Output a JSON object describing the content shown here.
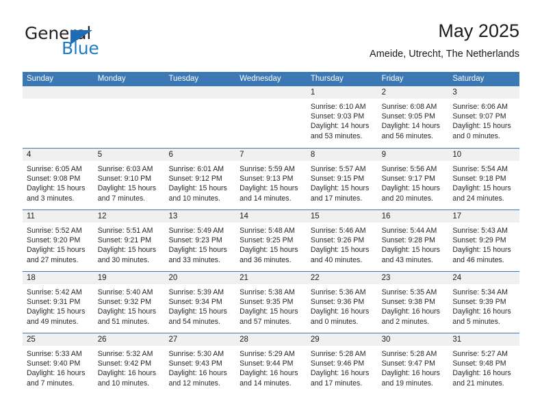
{
  "logo": {
    "word_top": "General",
    "word_bottom": "Blue",
    "accent_color": "#1a7cc2",
    "triangle_color": "#1f6cb4",
    "triangle_icon": "triangle-icon"
  },
  "header": {
    "title": "May 2025",
    "subtitle": "Ameide, Utrecht, The Netherlands"
  },
  "theme": {
    "header_blue": "#3b78b4",
    "daynum_band": "#f0f0f0",
    "text": "#262626"
  },
  "weekdays": [
    "Sunday",
    "Monday",
    "Tuesday",
    "Wednesday",
    "Thursday",
    "Friday",
    "Saturday"
  ],
  "weeks": [
    [
      {
        "date": "",
        "sunrise": "",
        "sunset": "",
        "daylight_a": "",
        "daylight_b": ""
      },
      {
        "date": "",
        "sunrise": "",
        "sunset": "",
        "daylight_a": "",
        "daylight_b": ""
      },
      {
        "date": "",
        "sunrise": "",
        "sunset": "",
        "daylight_a": "",
        "daylight_b": ""
      },
      {
        "date": "",
        "sunrise": "",
        "sunset": "",
        "daylight_a": "",
        "daylight_b": ""
      },
      {
        "date": "1",
        "sunrise": "Sunrise: 6:10 AM",
        "sunset": "Sunset: 9:03 PM",
        "daylight_a": "Daylight: 14 hours",
        "daylight_b": "and 53 minutes."
      },
      {
        "date": "2",
        "sunrise": "Sunrise: 6:08 AM",
        "sunset": "Sunset: 9:05 PM",
        "daylight_a": "Daylight: 14 hours",
        "daylight_b": "and 56 minutes."
      },
      {
        "date": "3",
        "sunrise": "Sunrise: 6:06 AM",
        "sunset": "Sunset: 9:07 PM",
        "daylight_a": "Daylight: 15 hours",
        "daylight_b": "and 0 minutes."
      }
    ],
    [
      {
        "date": "4",
        "sunrise": "Sunrise: 6:05 AM",
        "sunset": "Sunset: 9:08 PM",
        "daylight_a": "Daylight: 15 hours",
        "daylight_b": "and 3 minutes."
      },
      {
        "date": "5",
        "sunrise": "Sunrise: 6:03 AM",
        "sunset": "Sunset: 9:10 PM",
        "daylight_a": "Daylight: 15 hours",
        "daylight_b": "and 7 minutes."
      },
      {
        "date": "6",
        "sunrise": "Sunrise: 6:01 AM",
        "sunset": "Sunset: 9:12 PM",
        "daylight_a": "Daylight: 15 hours",
        "daylight_b": "and 10 minutes."
      },
      {
        "date": "7",
        "sunrise": "Sunrise: 5:59 AM",
        "sunset": "Sunset: 9:13 PM",
        "daylight_a": "Daylight: 15 hours",
        "daylight_b": "and 14 minutes."
      },
      {
        "date": "8",
        "sunrise": "Sunrise: 5:57 AM",
        "sunset": "Sunset: 9:15 PM",
        "daylight_a": "Daylight: 15 hours",
        "daylight_b": "and 17 minutes."
      },
      {
        "date": "9",
        "sunrise": "Sunrise: 5:56 AM",
        "sunset": "Sunset: 9:17 PM",
        "daylight_a": "Daylight: 15 hours",
        "daylight_b": "and 20 minutes."
      },
      {
        "date": "10",
        "sunrise": "Sunrise: 5:54 AM",
        "sunset": "Sunset: 9:18 PM",
        "daylight_a": "Daylight: 15 hours",
        "daylight_b": "and 24 minutes."
      }
    ],
    [
      {
        "date": "11",
        "sunrise": "Sunrise: 5:52 AM",
        "sunset": "Sunset: 9:20 PM",
        "daylight_a": "Daylight: 15 hours",
        "daylight_b": "and 27 minutes."
      },
      {
        "date": "12",
        "sunrise": "Sunrise: 5:51 AM",
        "sunset": "Sunset: 9:21 PM",
        "daylight_a": "Daylight: 15 hours",
        "daylight_b": "and 30 minutes."
      },
      {
        "date": "13",
        "sunrise": "Sunrise: 5:49 AM",
        "sunset": "Sunset: 9:23 PM",
        "daylight_a": "Daylight: 15 hours",
        "daylight_b": "and 33 minutes."
      },
      {
        "date": "14",
        "sunrise": "Sunrise: 5:48 AM",
        "sunset": "Sunset: 9:25 PM",
        "daylight_a": "Daylight: 15 hours",
        "daylight_b": "and 36 minutes."
      },
      {
        "date": "15",
        "sunrise": "Sunrise: 5:46 AM",
        "sunset": "Sunset: 9:26 PM",
        "daylight_a": "Daylight: 15 hours",
        "daylight_b": "and 40 minutes."
      },
      {
        "date": "16",
        "sunrise": "Sunrise: 5:44 AM",
        "sunset": "Sunset: 9:28 PM",
        "daylight_a": "Daylight: 15 hours",
        "daylight_b": "and 43 minutes."
      },
      {
        "date": "17",
        "sunrise": "Sunrise: 5:43 AM",
        "sunset": "Sunset: 9:29 PM",
        "daylight_a": "Daylight: 15 hours",
        "daylight_b": "and 46 minutes."
      }
    ],
    [
      {
        "date": "18",
        "sunrise": "Sunrise: 5:42 AM",
        "sunset": "Sunset: 9:31 PM",
        "daylight_a": "Daylight: 15 hours",
        "daylight_b": "and 49 minutes."
      },
      {
        "date": "19",
        "sunrise": "Sunrise: 5:40 AM",
        "sunset": "Sunset: 9:32 PM",
        "daylight_a": "Daylight: 15 hours",
        "daylight_b": "and 51 minutes."
      },
      {
        "date": "20",
        "sunrise": "Sunrise: 5:39 AM",
        "sunset": "Sunset: 9:34 PM",
        "daylight_a": "Daylight: 15 hours",
        "daylight_b": "and 54 minutes."
      },
      {
        "date": "21",
        "sunrise": "Sunrise: 5:38 AM",
        "sunset": "Sunset: 9:35 PM",
        "daylight_a": "Daylight: 15 hours",
        "daylight_b": "and 57 minutes."
      },
      {
        "date": "22",
        "sunrise": "Sunrise: 5:36 AM",
        "sunset": "Sunset: 9:36 PM",
        "daylight_a": "Daylight: 16 hours",
        "daylight_b": "and 0 minutes."
      },
      {
        "date": "23",
        "sunrise": "Sunrise: 5:35 AM",
        "sunset": "Sunset: 9:38 PM",
        "daylight_a": "Daylight: 16 hours",
        "daylight_b": "and 2 minutes."
      },
      {
        "date": "24",
        "sunrise": "Sunrise: 5:34 AM",
        "sunset": "Sunset: 9:39 PM",
        "daylight_a": "Daylight: 16 hours",
        "daylight_b": "and 5 minutes."
      }
    ],
    [
      {
        "date": "25",
        "sunrise": "Sunrise: 5:33 AM",
        "sunset": "Sunset: 9:40 PM",
        "daylight_a": "Daylight: 16 hours",
        "daylight_b": "and 7 minutes."
      },
      {
        "date": "26",
        "sunrise": "Sunrise: 5:32 AM",
        "sunset": "Sunset: 9:42 PM",
        "daylight_a": "Daylight: 16 hours",
        "daylight_b": "and 10 minutes."
      },
      {
        "date": "27",
        "sunrise": "Sunrise: 5:30 AM",
        "sunset": "Sunset: 9:43 PM",
        "daylight_a": "Daylight: 16 hours",
        "daylight_b": "and 12 minutes."
      },
      {
        "date": "28",
        "sunrise": "Sunrise: 5:29 AM",
        "sunset": "Sunset: 9:44 PM",
        "daylight_a": "Daylight: 16 hours",
        "daylight_b": "and 14 minutes."
      },
      {
        "date": "29",
        "sunrise": "Sunrise: 5:28 AM",
        "sunset": "Sunset: 9:46 PM",
        "daylight_a": "Daylight: 16 hours",
        "daylight_b": "and 17 minutes."
      },
      {
        "date": "30",
        "sunrise": "Sunrise: 5:28 AM",
        "sunset": "Sunset: 9:47 PM",
        "daylight_a": "Daylight: 16 hours",
        "daylight_b": "and 19 minutes."
      },
      {
        "date": "31",
        "sunrise": "Sunrise: 5:27 AM",
        "sunset": "Sunset: 9:48 PM",
        "daylight_a": "Daylight: 16 hours",
        "daylight_b": "and 21 minutes."
      }
    ]
  ]
}
